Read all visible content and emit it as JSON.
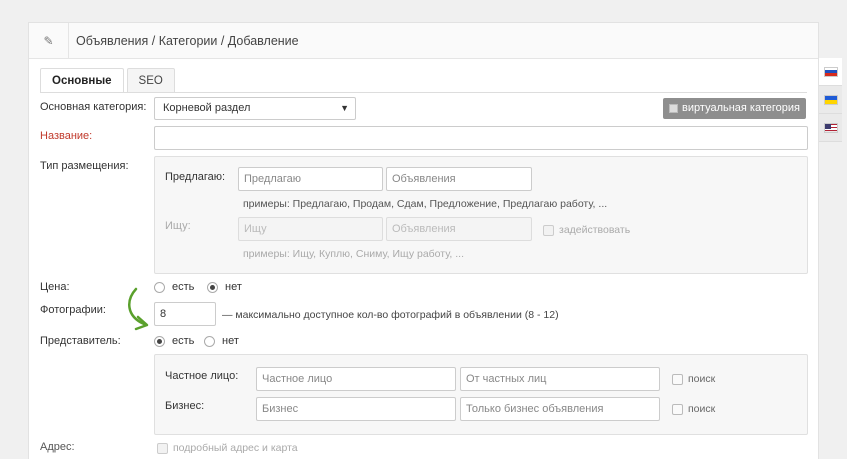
{
  "header": {
    "breadcrumb": "Объявления / Категории / Добавление",
    "icon": "edit-icon"
  },
  "tabs": [
    {
      "label": "Основные",
      "active": true
    },
    {
      "label": "SEO",
      "active": false
    }
  ],
  "form": {
    "category": {
      "label": "Основная категория:",
      "value": "Корневой раздел"
    },
    "virtual_button": "виртуальная категория",
    "name": {
      "label": "Название:",
      "value": ""
    },
    "placement": {
      "label": "Тип размещения:",
      "offer": {
        "label": "Предлагаю:",
        "placeholder1": "Предлагаю",
        "placeholder2": "Объявления",
        "hint": "примеры: Предлагаю, Продам, Сдам, Предложение, Предлагаю работу, ..."
      },
      "seek": {
        "label": "Ищу:",
        "placeholder1": "Ищу",
        "placeholder2": "Объявления",
        "checkbox": "задействовать",
        "hint": "примеры: Ищу, Куплю, Сниму, Ищу работу, ..."
      }
    },
    "price": {
      "label": "Цена:",
      "options": [
        "есть",
        "нет"
      ],
      "selected": "нет"
    },
    "photos": {
      "label": "Фотографии:",
      "value": "8",
      "hint": "— максимально доступное кол-во фотографий в объявлении (8 - 12)"
    },
    "representative": {
      "label": "Представитель:",
      "options": [
        "есть",
        "нет"
      ],
      "selected": "есть",
      "private": {
        "label": "Частное лицо:",
        "placeholder1": "Частное лицо",
        "placeholder2": "От частных лиц",
        "checkbox": "поиск"
      },
      "business": {
        "label": "Бизнес:",
        "placeholder1": "Бизнес",
        "placeholder2": "Только бизнес объявления",
        "checkbox": "поиск"
      }
    },
    "address": {
      "label": "Адрес:",
      "checkbox": "подробный адрес и карта"
    }
  },
  "languages": [
    {
      "name": "flag-ru-icon",
      "colors": [
        "#ffffff",
        "#1f4fbf",
        "#d52b1e"
      ],
      "active": true
    },
    {
      "name": "flag-ua-icon",
      "colors": [
        "#1f5bd6",
        "#ffd500"
      ],
      "active": false
    },
    {
      "name": "flag-us-icon",
      "colors": [
        "#b22234",
        "#ffffff",
        "#3c3b6e"
      ],
      "active": false
    }
  ],
  "colors": {
    "accent_label": "#c0392b",
    "arrow": "#5aa02c",
    "virtual_button_bg": "#8e8e8e"
  }
}
